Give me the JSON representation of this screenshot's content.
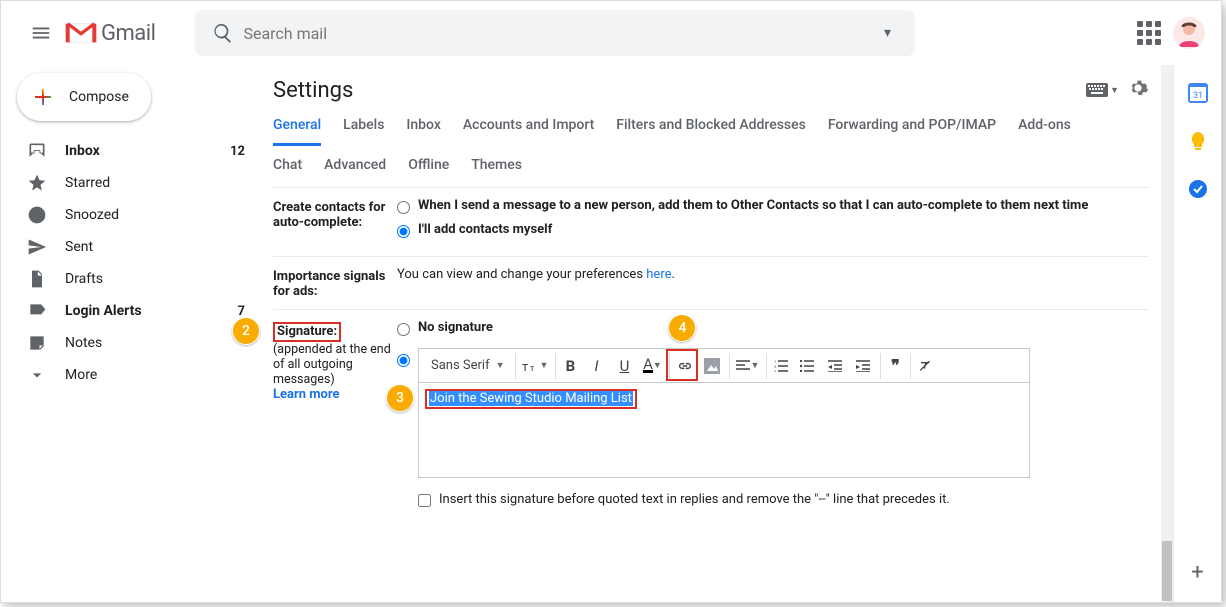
{
  "brand": "Gmail",
  "search": {
    "placeholder": "Search mail"
  },
  "compose_label": "Compose",
  "nav": [
    {
      "icon": "inbox",
      "label": "Inbox",
      "count": "12",
      "bold": true
    },
    {
      "icon": "star",
      "label": "Starred"
    },
    {
      "icon": "clock",
      "label": "Snoozed"
    },
    {
      "icon": "send",
      "label": "Sent"
    },
    {
      "icon": "file",
      "label": "Drafts"
    },
    {
      "icon": "tag",
      "label": "Login Alerts",
      "count": "7",
      "bold": true
    },
    {
      "icon": "note",
      "label": "Notes"
    },
    {
      "icon": "more",
      "label": "More"
    }
  ],
  "page_title": "Settings",
  "tabs_row1": [
    "General",
    "Labels",
    "Inbox",
    "Accounts and Import",
    "Filters and Blocked Addresses",
    "Forwarding and POP/IMAP",
    "Add-ons"
  ],
  "tabs_row2": [
    "Chat",
    "Advanced",
    "Offline",
    "Themes"
  ],
  "active_tab": "General",
  "contacts": {
    "label": "Create contacts for auto-complete:",
    "opt1": "When I send a message to a new person, add them to Other Contacts so that I can auto-complete to them next time",
    "opt2": "I'll add contacts myself"
  },
  "importance": {
    "label": "Importance signals for ads:",
    "text_pre": "You can view and change your preferences ",
    "link": "here",
    "text_post": "."
  },
  "signature": {
    "label": "Signature:",
    "hint": "(appended at the end of all outgoing messages)",
    "learn": "Learn more",
    "no_sig": "No signature",
    "font": "Sans Serif",
    "content": "Join the Sewing Studio Mailing List",
    "checkbox_label": "Insert this signature before quoted text in replies and remove the \"--\" line that precedes it."
  },
  "annotations": {
    "sig": "2",
    "text": "3",
    "link": "4"
  },
  "rail": {
    "calendar_day": "31"
  }
}
